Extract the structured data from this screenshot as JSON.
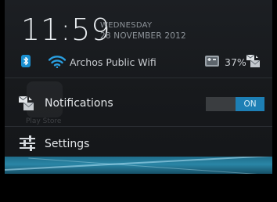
{
  "header": {
    "time": "11:59",
    "day": "WEDNESDAY",
    "date": "28 NOVEMBER 2012"
  },
  "status": {
    "wifi_name": "Archos Public Wifi",
    "battery": "37%"
  },
  "background": {
    "app_label": "Play Store"
  },
  "notifications": {
    "label": "Notifications",
    "toggle_label": "ON",
    "enabled": true
  },
  "settings": {
    "label": "Settings"
  },
  "colors": {
    "accent": "#1d7fb5",
    "bluetooth": "#1a8fd0",
    "wifi": "#2a9fe0"
  },
  "icons": {
    "bluetooth": "bluetooth-icon",
    "wifi": "wifi-icon",
    "battery": "battery-icon",
    "notifications": "notifications-icon",
    "settings": "settings-sliders-icon"
  }
}
